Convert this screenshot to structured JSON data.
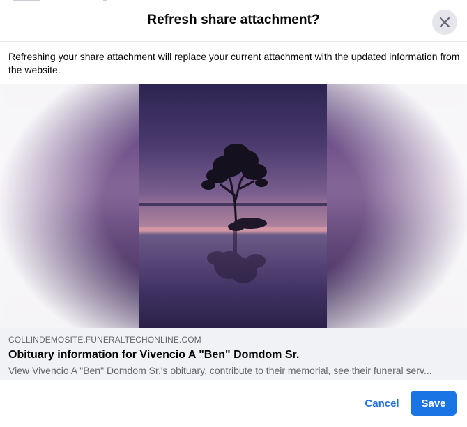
{
  "dialog": {
    "title": "Refresh share attachment?",
    "description": "Refreshing your share attachment will replace your current attachment with the updated information from the website."
  },
  "attachment": {
    "domain": "COLLINDEMOSITE.FUNERALTECHONLINE.COM",
    "title": "Obituary information for Vivencio A \"Ben\" Domdom Sr.",
    "description": "View Vivencio A \"Ben\" Domdom Sr.'s obituary, contribute to their memorial, see their funeral serv..."
  },
  "footer": {
    "cancel_label": "Cancel",
    "save_label": "Save"
  },
  "icons": {
    "close": "close-icon"
  },
  "colors": {
    "primary_button": "#1b74e4",
    "link_text": "#216fdb",
    "close_button_bg": "#e4e6eb",
    "meta_bg": "#f0f2f5"
  }
}
